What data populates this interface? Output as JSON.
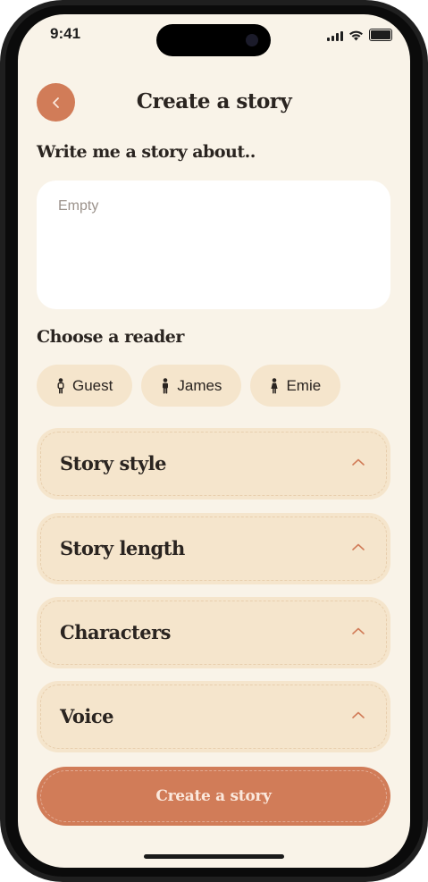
{
  "status_bar": {
    "time": "9:41"
  },
  "header": {
    "title": "Create a story",
    "back_icon": "chevron-left-icon"
  },
  "prompt": {
    "heading": "Write me a story about..",
    "placeholder": "Empty",
    "value": ""
  },
  "reader": {
    "heading": "Choose a reader",
    "options": [
      {
        "label": "Guest",
        "icon": "child-figure-icon"
      },
      {
        "label": "James",
        "icon": "boy-figure-icon"
      },
      {
        "label": "Emie",
        "icon": "girl-figure-icon"
      }
    ]
  },
  "sections": [
    {
      "label": "Story style",
      "icon": "chevron-up-icon"
    },
    {
      "label": "Story length",
      "icon": "chevron-up-icon"
    },
    {
      "label": "Characters",
      "icon": "chevron-up-icon"
    },
    {
      "label": "Voice",
      "icon": "chevron-up-icon"
    }
  ],
  "cta": {
    "label": "Create a story"
  },
  "colors": {
    "background": "#f9f3e8",
    "accent": "#d17c58",
    "card": "#f5e5cc",
    "text": "#2a2420"
  }
}
